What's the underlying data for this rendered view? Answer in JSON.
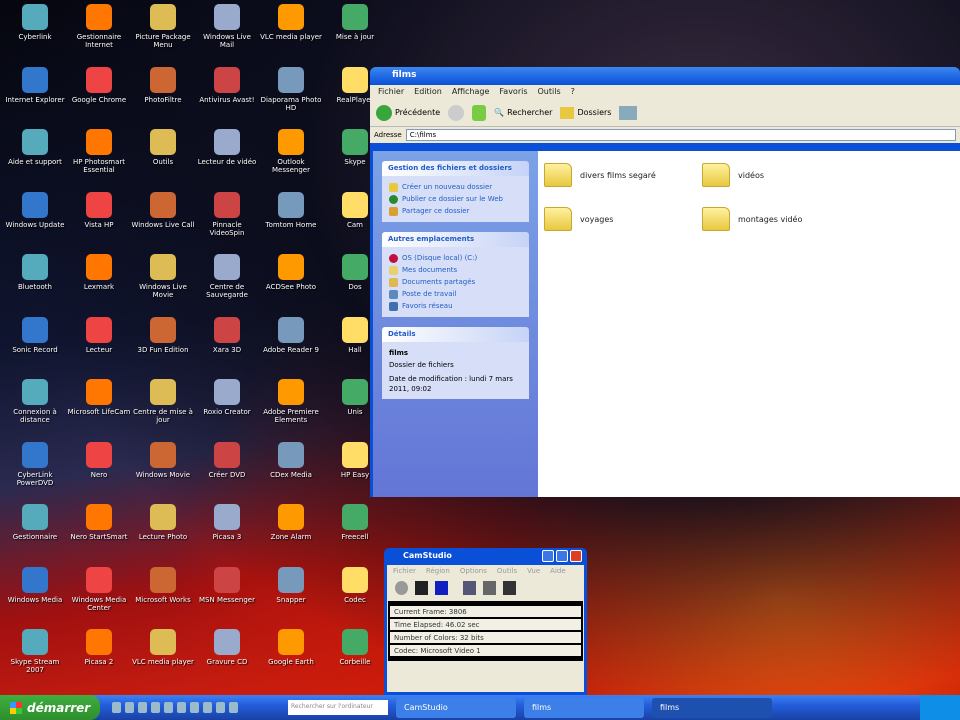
{
  "desktop": {
    "icons": [
      "Cyberlink",
      "Gestionnaire Internet",
      "Picture Package Menu",
      "Windows Live Mail",
      "VLC media player",
      "Mise à jour",
      "Internet Explorer",
      "Google Chrome",
      "PhotoFiltre",
      "Antivirus Avast!",
      "Diaporama Photo HD",
      "RealPlayer",
      "Aide et support",
      "HP Photosmart Essential",
      "Outils",
      "Lecteur de vidéo",
      "Outlook Messenger",
      "Skype",
      "Windows Update",
      "Vista HP",
      "Windows Live Call",
      "Pinnacle VideoSpin",
      "Tomtom Home",
      "Cam",
      "Bluetooth",
      "Lexmark",
      "Windows Live Movie",
      "Centre de Sauvegarde",
      "ACDSee Photo",
      "Dos",
      "Sonic Record",
      "Lecteur",
      "3D Fun Edition",
      "Xara 3D",
      "Adobe Reader 9",
      "Hall",
      "Connexion à distance",
      "Microsoft LifeCam",
      "Centre de mise à jour",
      "Roxio Creator",
      "Adobe Premiere Elements",
      "Unis",
      "CyberLink PowerDVD",
      "Nero",
      "Windows Movie",
      "Créer DVD",
      "CDex Media",
      "HP Easy",
      "Gestionnaire",
      "Nero StartSmart",
      "Lecture Photo",
      "Picasa 3",
      "Zone Alarm",
      "Freecell",
      "Windows Media",
      "Windows Media Center",
      "Microsoft Works",
      "MSN Messenger",
      "Snapper",
      "Codec",
      "Skype Stream 2007",
      "Picasa 2",
      "VLC media player",
      "Gravure CD",
      "Google Earth",
      "Corbeille"
    ]
  },
  "explorer": {
    "title": "films",
    "menu": [
      "Fichier",
      "Edition",
      "Affichage",
      "Favoris",
      "Outils",
      "?"
    ],
    "toolbar": {
      "back": "Précédente",
      "search": "Rechercher",
      "folders": "Dossiers"
    },
    "address_label": "Adresse",
    "address": "C:\\films",
    "tasks_title": "Gestion des fichiers et dossiers",
    "tasks": [
      "Créer un nouveau dossier",
      "Publier ce dossier sur le Web",
      "Partager ce dossier"
    ],
    "places_title": "Autres emplacements",
    "places": [
      "OS (Disque local) (C:)",
      "Mes documents",
      "Documents partagés",
      "Poste de travail",
      "Favoris réseau"
    ],
    "details_title": "Détails",
    "details": {
      "name": "films",
      "type": "Dossier de fichiers",
      "modified": "Date de modification : lundi 7 mars 2011, 09:02"
    },
    "folders": [
      "divers films segaré",
      "vidéos",
      "voyages",
      "montages vidéo"
    ]
  },
  "camstudio": {
    "title": "CamStudio",
    "menu": [
      "Fichier",
      "Région",
      "Options",
      "Outils",
      "Vue",
      "Aide"
    ],
    "stats": [
      "Current Frame: 3806",
      "Time Elapsed: 46.02 sec",
      "Number of Colors: 32 bits",
      "Codec: Microsoft Video 1"
    ]
  },
  "taskbar": {
    "start": "démarrer",
    "search_placeholder": "Rechercher sur l'ordinateur",
    "tasks": [
      "CamStudio",
      "films",
      "films"
    ]
  }
}
